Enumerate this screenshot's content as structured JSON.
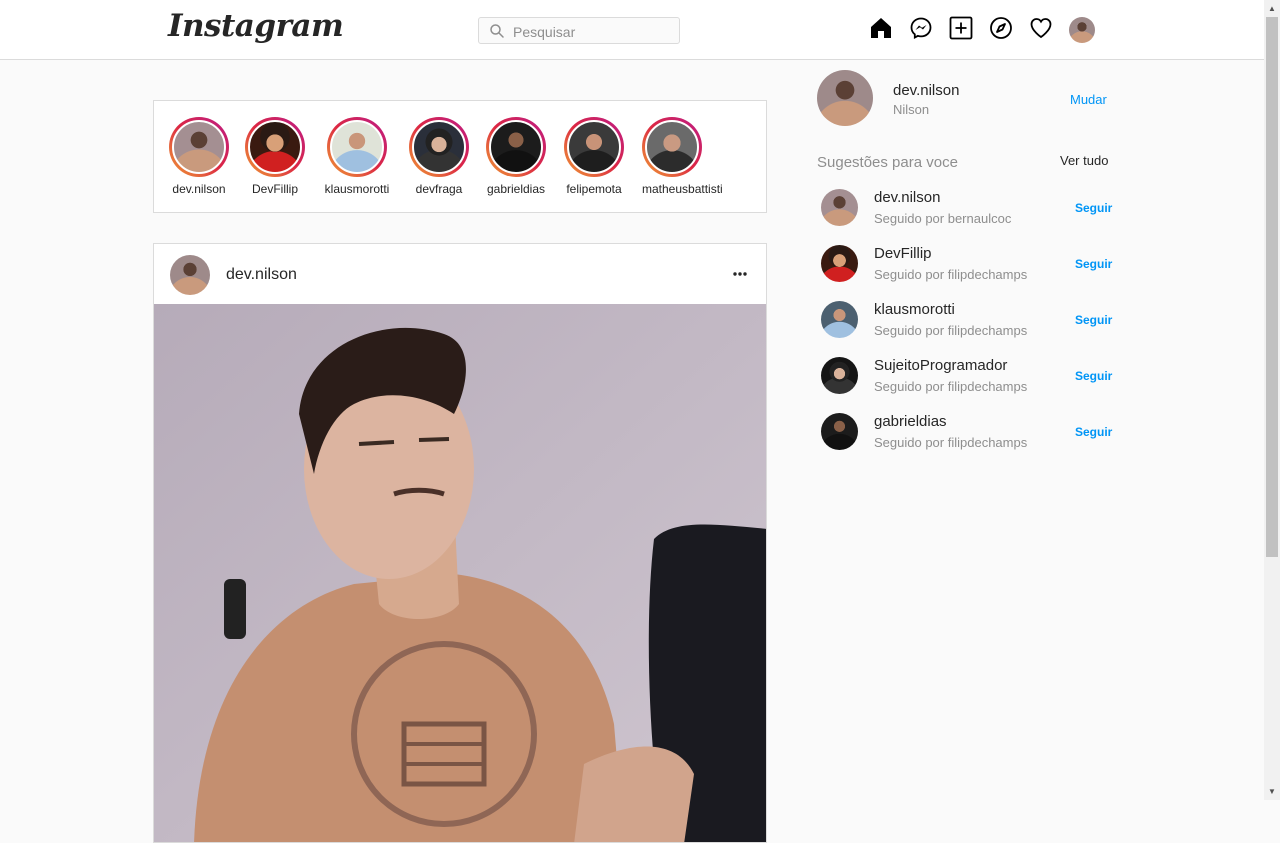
{
  "header": {
    "logo": "Instagram",
    "search_placeholder": "Pesquisar"
  },
  "stories": [
    {
      "username": "dev.nilson",
      "avatar": "person-tan-shirt"
    },
    {
      "username": "DevFillip",
      "avatar": "person-glasses-red"
    },
    {
      "username": "klausmorotti",
      "avatar": "person-blue-shirt"
    },
    {
      "username": "devfraga",
      "avatar": "person-headphones"
    },
    {
      "username": "gabrieldias",
      "avatar": "person-dark"
    },
    {
      "username": "felipemota",
      "avatar": "person-dark-shirt"
    },
    {
      "username": "matheusbattisti",
      "avatar": "person-beard"
    }
  ],
  "post": {
    "username": "dev.nilson",
    "menu_icon": "more-horizontal-icon"
  },
  "sidebar": {
    "me": {
      "username": "dev.nilson",
      "name": "Nilson"
    },
    "switch_label": "Mudar",
    "suggestions_title": "Sugestões para voce",
    "see_all": "Ver tudo",
    "suggestions": [
      {
        "username": "dev.nilson",
        "followed_by": "Seguido por bernaulcoc",
        "follow_label": "Seguir"
      },
      {
        "username": "DevFillip",
        "followed_by": "Seguido por filipdechamps",
        "follow_label": "Seguir"
      },
      {
        "username": "klausmorotti",
        "followed_by": "Seguido por filipdechamps",
        "follow_label": "Seguir"
      },
      {
        "username": "SujeitoProgramador",
        "followed_by": "Seguido por filipdechamps",
        "follow_label": "Seguir"
      },
      {
        "username": "gabrieldias",
        "followed_by": "Seguido por filipdechamps",
        "follow_label": "Seguir"
      }
    ]
  },
  "colors": {
    "link": "#0095f6",
    "border": "#dbdbdb",
    "background": "#fafafa"
  }
}
